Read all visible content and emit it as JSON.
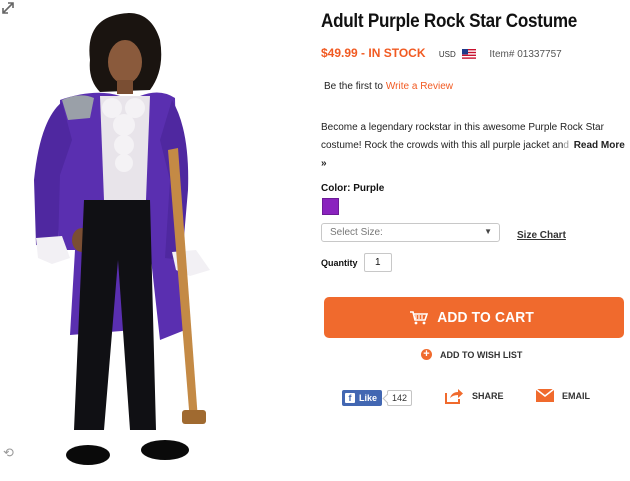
{
  "product": {
    "title": "Adult Purple Rock Star Costume",
    "price": "$49.99 - IN STOCK",
    "currency": "USD",
    "item_number": "Item# 01337757",
    "image_alt_icons": [
      "rotate-icon",
      "expand-icon"
    ]
  },
  "reviews": {
    "prompt": "Be the first to",
    "link": "Write a Review"
  },
  "description": {
    "line1": "Become a legendary rockstar in this awesome Purple Rock Star",
    "line2_visible": "costume! Rock the crowds with this all purple jacket an",
    "line2_faded": "d",
    "read_more": "Read More »"
  },
  "options": {
    "color_label": "Color: Purple",
    "color_swatch": "#8a23be",
    "size_placeholder": "Select Size:",
    "size_chart": "Size Chart",
    "quantity_label": "Quantity",
    "quantity_value": "1"
  },
  "actions": {
    "add_to_cart": "ADD TO CART",
    "wishlist": "ADD TO WISH LIST",
    "fb_like": "Like",
    "fb_count": "142",
    "share": "SHARE",
    "email": "EMAIL"
  },
  "colors": {
    "accent": "#f06a2d",
    "price": "#f15a22",
    "facebook": "#4267b2"
  }
}
